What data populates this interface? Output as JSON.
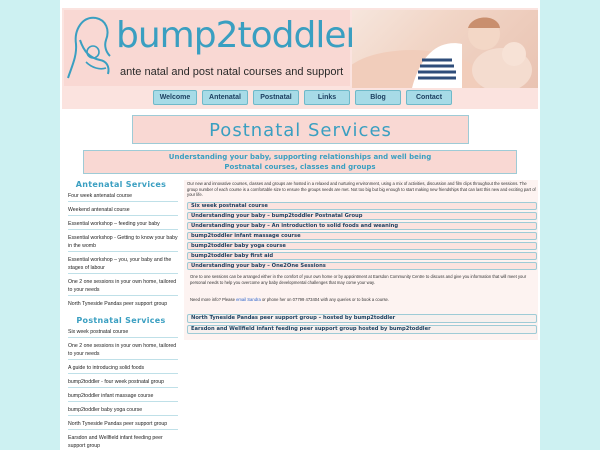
{
  "header": {
    "logo_text": "bump2toddler",
    "tagline": "ante natal and post natal courses and support"
  },
  "nav": {
    "items": [
      "Welcome",
      "Antenatal",
      "Postnatal",
      "Links",
      "Blog",
      "Contact"
    ]
  },
  "page": {
    "title": "Postnatal Services",
    "subtitle_line1": "Understanding your baby, supporting relationships and well being",
    "subtitle_line2": "Postnatal courses, classes and groups"
  },
  "sidebar": {
    "antenatal_heading": "Antenatal Services",
    "antenatal_items": [
      "Four week antenatal course",
      "Weekend antenatal course",
      "Essential workshop – feeding your baby",
      "Essential workshop - Getting to know your baby in the womb",
      "Essential workshop – you, your baby and the stages of labour",
      "One 2 one sessions in your own home, tailored to your needs",
      "North Tyneside Pandas peer support group"
    ],
    "postnatal_heading": "Postnatal Services",
    "postnatal_items": [
      "Six week postnatal course",
      "One 2 one sessions in your own home, tailored to your needs",
      "A guide to introducing solid foods",
      "bump2toddler - four week postnatal group",
      "bump2toddler infant massage course",
      "bump2toddler baby yoga course",
      "North Tyneside Pandas peer support group",
      "Earsdon and Wellfield infant feeding peer support group"
    ]
  },
  "main": {
    "intro": "Our new and innovative courses, classes and groups are hosted in a relaxed and nurturing environment, using a mix of activities, discussion and film clips throughout the sessions. The group number of each course is a comfortable size to ensure the groups needs are met. Not too big but big enough to start making new friendships that can last this new and exciting part of your life.",
    "courses": [
      "Six week postnatal course",
      "Understanding your baby – bump2toddler Postnatal Group",
      "Understanding your baby – An introduction to solid foods and weaning",
      "bump2toddler infant massage course",
      "bump2toddler baby yoga course",
      "bump2toddler baby first aid",
      "Understanding your baby – One2One Sessions"
    ],
    "one2one_text": "One to one sessions can be arranged either in the comfort of your own home or by appointment at Earsdon Community Centre to discuss and give you information that will meet your personal needs to help you overcome any baby developmental challenges that may come your way.",
    "info_prefix": "Need more info? Please ",
    "info_link": "email Sandra",
    "info_suffix": " or phone her on 07799 473404 with any queries or to book a course.",
    "groups": [
      "North Tyneside Pandas peer support group – hosted by bump2toddler",
      "Earsdon and Wellfield infant feeding peer support group hosted by bump2toddler"
    ]
  },
  "colors": {
    "accent": "#3a9fc1",
    "nav_button": "#a7dbe7",
    "pink_panel": "#f9d8d3",
    "background": "#cdf1f2"
  }
}
